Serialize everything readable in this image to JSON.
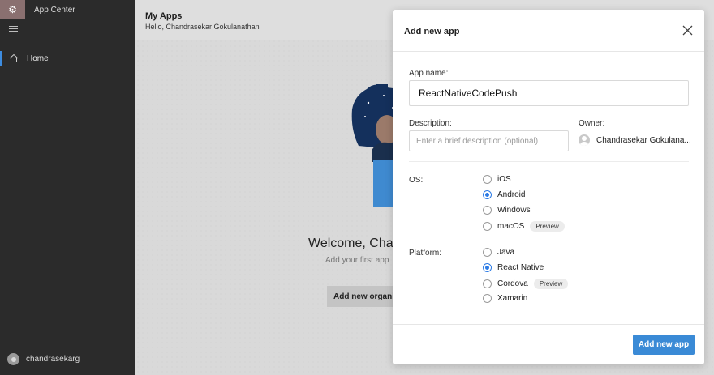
{
  "sidebar": {
    "app_title": "App Center",
    "logo_glyph": "⚙",
    "nav_home": "Home",
    "username": "chandrasekarg"
  },
  "main": {
    "title": "My Apps",
    "greeting": "Hello, Chandrasekar Gokulanathan",
    "welcome": "Welcome, Chan",
    "subline": "Add your first app",
    "org_button": "Add new organi"
  },
  "modal": {
    "title": "Add new app",
    "app_name_label": "App name:",
    "app_name_value": "ReactNativeCodePush",
    "description_label": "Description:",
    "description_placeholder": "Enter a brief description (optional)",
    "owner_label": "Owner:",
    "owner_name": "Chandrasekar Gokulana...",
    "os_label": "OS:",
    "os_options": [
      {
        "label": "iOS",
        "checked": false,
        "badge": ""
      },
      {
        "label": "Android",
        "checked": true,
        "badge": ""
      },
      {
        "label": "Windows",
        "checked": false,
        "badge": ""
      },
      {
        "label": "macOS",
        "checked": false,
        "badge": "Preview"
      }
    ],
    "platform_label": "Platform:",
    "platform_options": [
      {
        "label": "Java",
        "checked": false,
        "badge": ""
      },
      {
        "label": "React Native",
        "checked": true,
        "badge": ""
      },
      {
        "label": "Cordova",
        "checked": false,
        "badge": "Preview"
      },
      {
        "label": "Xamarin",
        "checked": false,
        "badge": ""
      }
    ],
    "submit_label": "Add new app"
  },
  "colors": {
    "accent": "#3a8ad6",
    "sidebar_bg": "#2b2b2b",
    "radio_checked": "#2c7be5"
  },
  "icons": {
    "logo": "app-center-logo-icon",
    "menu": "hamburger-icon",
    "home": "home-icon",
    "close": "close-icon",
    "avatar": "user-avatar-icon"
  }
}
